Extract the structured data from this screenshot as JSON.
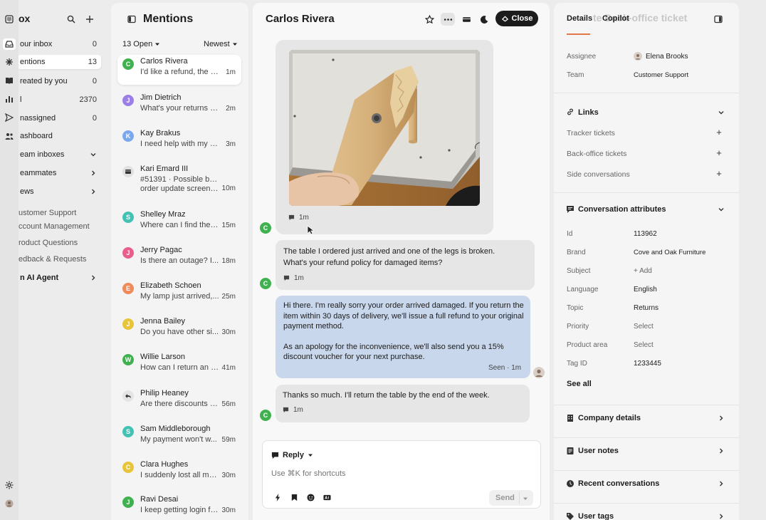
{
  "nav": {
    "title": "ox",
    "items": [
      {
        "label": "our inbox",
        "count": "0"
      },
      {
        "label": "entions",
        "count": "13"
      },
      {
        "label": "reated by you",
        "count": "0"
      },
      {
        "label": "l",
        "count": "2370"
      },
      {
        "label": "nassigned",
        "count": "0"
      },
      {
        "label": "ashboard",
        "count": ""
      },
      {
        "label": "eam inboxes",
        "count": ""
      },
      {
        "label": "eammates",
        "count": ""
      },
      {
        "label": "ews",
        "count": ""
      }
    ],
    "views": [
      "ustomer Support",
      "ccount Management",
      "roduct Questions",
      "edback & Requests"
    ],
    "ai_agent": "n AI Agent"
  },
  "list": {
    "title": "Mentions",
    "filter_open": "13 Open",
    "filter_sort": "Newest",
    "conversations": [
      {
        "initial": "C",
        "color": "#3fb14e",
        "name": "Carlos Rivera",
        "preview": "I'd like a refund, the s...",
        "preview2": "",
        "time": "1m"
      },
      {
        "initial": "J",
        "color": "#9b7ee6",
        "name": "Jim Dietrich",
        "preview": "What's your returns po...",
        "preview2": "",
        "time": "2m"
      },
      {
        "initial": "K",
        "color": "#7aa8ef",
        "name": "Kay Brakus",
        "preview": "I need help with my or...",
        "preview2": "",
        "time": "3m"
      },
      {
        "initial": "",
        "color": "#d9d9d9",
        "name": "Kari Emard III",
        "preview": "#51391 · Possible bug in",
        "preview2": "order update screen no...",
        "time": "10m"
      },
      {
        "initial": "S",
        "color": "#43c2b4",
        "name": "Shelley Mraz",
        "preview": "Where can I find the l...",
        "preview2": "",
        "time": "15m"
      },
      {
        "initial": "J",
        "color": "#e85d8a",
        "name": "Jerry Pagac",
        "preview": "Is there an outage? I...",
        "preview2": "",
        "time": "18m"
      },
      {
        "initial": "E",
        "color": "#ef8a5b",
        "name": "Elizabeth Schoen",
        "preview": "My lamp just arrived,...",
        "preview2": "",
        "time": "25m"
      },
      {
        "initial": "J",
        "color": "#e8c43a",
        "name": "Jenna Bailey",
        "preview": "Do you have other si...",
        "preview2": "",
        "time": "30m"
      },
      {
        "initial": "W",
        "color": "#3fb14e",
        "name": "Willie Larson",
        "preview": "How can I return an it...",
        "preview2": "",
        "time": "41m"
      },
      {
        "initial": "",
        "color": "#e4e4e4",
        "name": "Philip Heaney",
        "preview": "Are there discounts a...",
        "preview2": "",
        "time": "56m"
      },
      {
        "initial": "S",
        "color": "#43c2b4",
        "name": "Sam Middleborough",
        "preview": "My payment won't w...",
        "preview2": "",
        "time": "59m"
      },
      {
        "initial": "C",
        "color": "#e8c43a",
        "name": "Clara Hughes",
        "preview": "I suddenly lost all my a...",
        "preview2": "",
        "time": "30m"
      },
      {
        "initial": "J",
        "color": "#3fb14e",
        "name": "Ravi Desai",
        "preview": "I keep getting login fail...",
        "preview2": "",
        "time": "30m"
      }
    ]
  },
  "conversation": {
    "title": "Carlos Rivera",
    "close_label": "Close",
    "photo_time": "1m",
    "customer_initial": "C",
    "msg1": {
      "line1": "The table I ordered just arrived and one of the legs is broken.",
      "line2": "What's your refund policy for damaged items?",
      "time": "1m"
    },
    "msg2": {
      "line1": "Hi there. I'm really sorry your order arrived damaged. If you return the",
      "line2": "item within 30 days of delivery, we'll issue a full refund to your original",
      "line3": "payment method.",
      "line4": "As an apology for the inconvenience, we'll also send you a 15%",
      "line5": "discount voucher for your next purchase.",
      "status": "Seen · 1m"
    },
    "msg3": {
      "text": "Thanks so much. I'll return the table by the end of the week.",
      "time": "1m"
    }
  },
  "composer": {
    "mode": "Reply",
    "placeholder": "Use ⌘K for shortcuts",
    "send_label": "Send"
  },
  "side": {
    "tabs": [
      "Details",
      "Copilot"
    ],
    "ghost_title": "te Back-office ticket",
    "assignee_label": "Assignee",
    "assignee_value": "Elena Brooks",
    "team_label": "Team",
    "team_value": "Customer Support",
    "links_title": "Links",
    "links": [
      "Tracker tickets",
      "Back-office tickets",
      "Side conversations"
    ],
    "attrs_title": "Conversation attributes",
    "attrs": [
      {
        "label": "Id",
        "value": "113962",
        "muted": false
      },
      {
        "label": "Brand",
        "value": "Cove and Oak Furniture",
        "muted": false
      },
      {
        "label": "Subject",
        "value": "+ Add",
        "muted": true
      },
      {
        "label": "Language",
        "value": "English",
        "muted": false
      },
      {
        "label": "Topic",
        "value": "Returns",
        "muted": false
      },
      {
        "label": "Priority",
        "value": "Select",
        "muted": true
      },
      {
        "label": "Product area",
        "value": "Select",
        "muted": true
      },
      {
        "label": "Tag ID",
        "value": "1233445",
        "muted": false
      }
    ],
    "see_all": "See all",
    "sections": [
      "Company details",
      "User notes",
      "Recent conversations",
      "User tags"
    ]
  }
}
